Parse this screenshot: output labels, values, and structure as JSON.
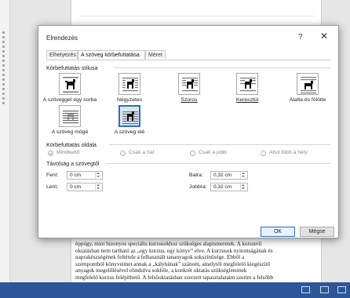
{
  "dialog": {
    "title": "Elrendezés",
    "help": "?",
    "close": "✕",
    "tabs": [
      "Elhelyezés",
      "A szöveg körbefuttatása",
      "Méret"
    ],
    "active_tab": 1
  },
  "wrap_style": {
    "title": "Körbefuttatás stílusa",
    "options": [
      {
        "label": "A szöveggel egy sorba",
        "icon": "inline-with-text-icon",
        "selected": false
      },
      {
        "label": "Négyzetes",
        "icon": "square-wrap-icon",
        "selected": false
      },
      {
        "label": "Szoros",
        "icon": "tight-wrap-icon",
        "selected": false
      },
      {
        "label": "Keresztül",
        "icon": "through-wrap-icon",
        "selected": false
      },
      {
        "label": "Alatta és fölötte",
        "icon": "top-bottom-wrap-icon",
        "selected": false
      },
      {
        "label": "A szöveg mögé",
        "icon": "behind-text-icon",
        "selected": false
      },
      {
        "label": "A szöveg elé",
        "icon": "in-front-of-text-icon",
        "selected": true
      }
    ]
  },
  "wrap_side": {
    "title": "Körbefuttatás oldala",
    "options": [
      "Mindkettő",
      "Csak a bal",
      "Csak a jobb",
      "Ahol több a hely"
    ],
    "selected": 0
  },
  "distance": {
    "title": "Távolság a szövegtől",
    "top_label": "Fent:",
    "top_value": "0 cm",
    "bottom_label": "Lent:",
    "bottom_value": "0 cm",
    "left_label": "Balra:",
    "left_value": "0,32 cm",
    "right_label": "Jobbra:",
    "right_value": "0,32 cm"
  },
  "buttons": {
    "ok": "OK",
    "cancel": "Mégse"
  },
  "document": {
    "lines": [
      "éppúgy, mint bizonyos speciális kurzusokhoz szükséges alapismeretek. A korszerű",
      "oktatásban nem tartható az „egy kurzus, egy könyv” elve. A kurzusok nyitottságának és",
      "naprakészségének feltétele a felhasznált tananyagok sokszínűsége. Ebből a",
      "szempontból könyveimet annak a „kályhának” szánom, amelytől megfelelő kiegészítő",
      "anyagok megelőlésével elindulva sokféle, a konkrét oktatás szükségleteinek",
      "megfelelő kurzus felépíthető. A felsőoktatásban szerzett tapasztalataim szerint a felsőbb"
    ]
  },
  "colors": {
    "accent": "#2a6ebb",
    "statusbar": "#2b579a"
  }
}
